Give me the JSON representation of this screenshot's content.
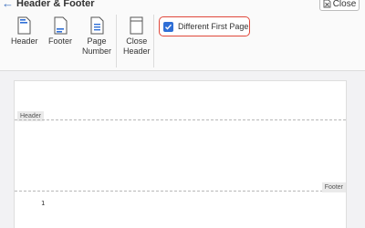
{
  "window": {
    "title": "Header & Footer",
    "close_label": "Close"
  },
  "toolbar": {
    "header_label": "Header",
    "footer_label": "Footer",
    "page_number_line1": "Page",
    "page_number_line2": "Number",
    "close_header_line1": "Close",
    "close_header_line2": "Header",
    "different_first_page_label": "Different First Page",
    "different_first_page_checked": true
  },
  "document": {
    "header_tag": "Header",
    "footer_tag": "Footer",
    "page_number": "1"
  },
  "colors": {
    "accent": "#2f6fd6",
    "highlight_border": "#e0473a"
  }
}
